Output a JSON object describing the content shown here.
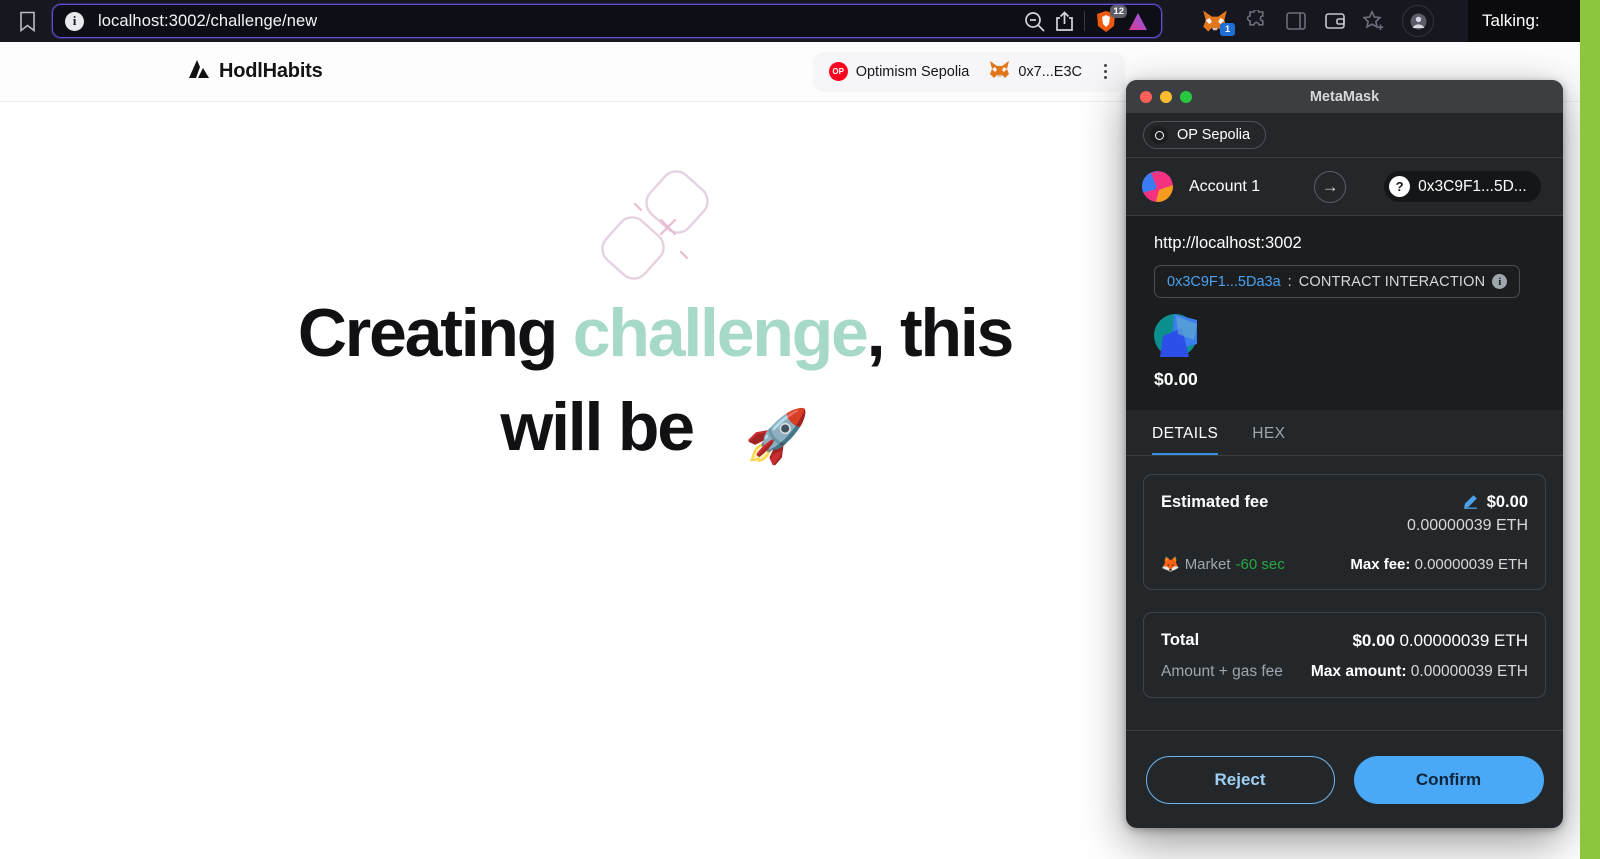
{
  "browser": {
    "url": "localhost:3002/challenge/new",
    "bookmark_icon": "bookmark-icon",
    "info_icon": "site-info-icon",
    "zoom_out_icon": "zoom-out-icon",
    "share_icon": "share-icon",
    "brave_shield_badge": "12",
    "brave_icon": "brave-shield-icon",
    "leo_icon": "leo-ai-triangle-icon",
    "metamask_icon": "metamask-fox-icon",
    "metamask_badge": "1",
    "puzzle_icon": "extensions-puzzle-icon",
    "sidebar_icon": "sidebar-panel-icon",
    "wallet_icon": "wallet-icon",
    "bookmark_star_icon": "bookmark-star-icon",
    "account_icon": "profile-account-icon",
    "talking_label": "Talking:"
  },
  "site": {
    "brand": "HodlHabits",
    "brand_icon": "hodlhabits-logo-icon",
    "network": {
      "label": "Optimism Sepolia",
      "badge_text": "OP",
      "badge_color": "#ff0420"
    },
    "account": {
      "label": "0x7...E3C",
      "icon": "metamask-fox-icon"
    },
    "menu_icon": "kebab-menu-icon",
    "hero": {
      "line1_a": "Creating ",
      "line1_highlight": "challenge",
      "line1_b": ", this",
      "line2": "will be",
      "rocket": "🚀",
      "highlight_color": "#a6d9c7",
      "decoration_icon": "chain-link-decoration-icon"
    }
  },
  "metamask": {
    "window_title": "MetaMask",
    "traffic_lights": [
      "close",
      "minimize",
      "maximize"
    ],
    "network_chip": "OP Sepolia",
    "account_name": "Account 1",
    "arrow_icon": "transfer-arrow-icon",
    "recipient": "0x3C9F1...5D...",
    "recipient_help_icon": "question-mark-icon",
    "origin_url": "http://localhost:3002",
    "contract_address": "0x3C9F1...5Da3a",
    "contract_separator": ":",
    "contract_type": "CONTRACT INTERACTION",
    "contract_info_icon": "info-icon",
    "amount": "$0.00",
    "tabs": [
      {
        "label": "DETAILS",
        "active": true
      },
      {
        "label": "HEX",
        "active": false
      }
    ],
    "fee_card": {
      "title": "Estimated fee",
      "edit_icon": "pencil-edit-icon",
      "usd": "$0.00",
      "eth": "0.00000039 ETH",
      "market_icon": "🦊",
      "market_label": "Market",
      "market_time": "-60 sec",
      "max_fee_label": "Max fee:",
      "max_fee_value": "0.00000039 ETH"
    },
    "total_card": {
      "title": "Total",
      "usd": "$0.00",
      "eth": "0.00000039 ETH",
      "subtitle": "Amount + gas fee",
      "max_amount_label": "Max amount:",
      "max_amount_value": "0.00000039 ETH"
    },
    "buttons": {
      "reject": "Reject",
      "confirm": "Confirm"
    },
    "colors": {
      "accent_blue": "#4aa9f7",
      "link_blue": "#4aa2ef",
      "green": "#28a745"
    }
  }
}
